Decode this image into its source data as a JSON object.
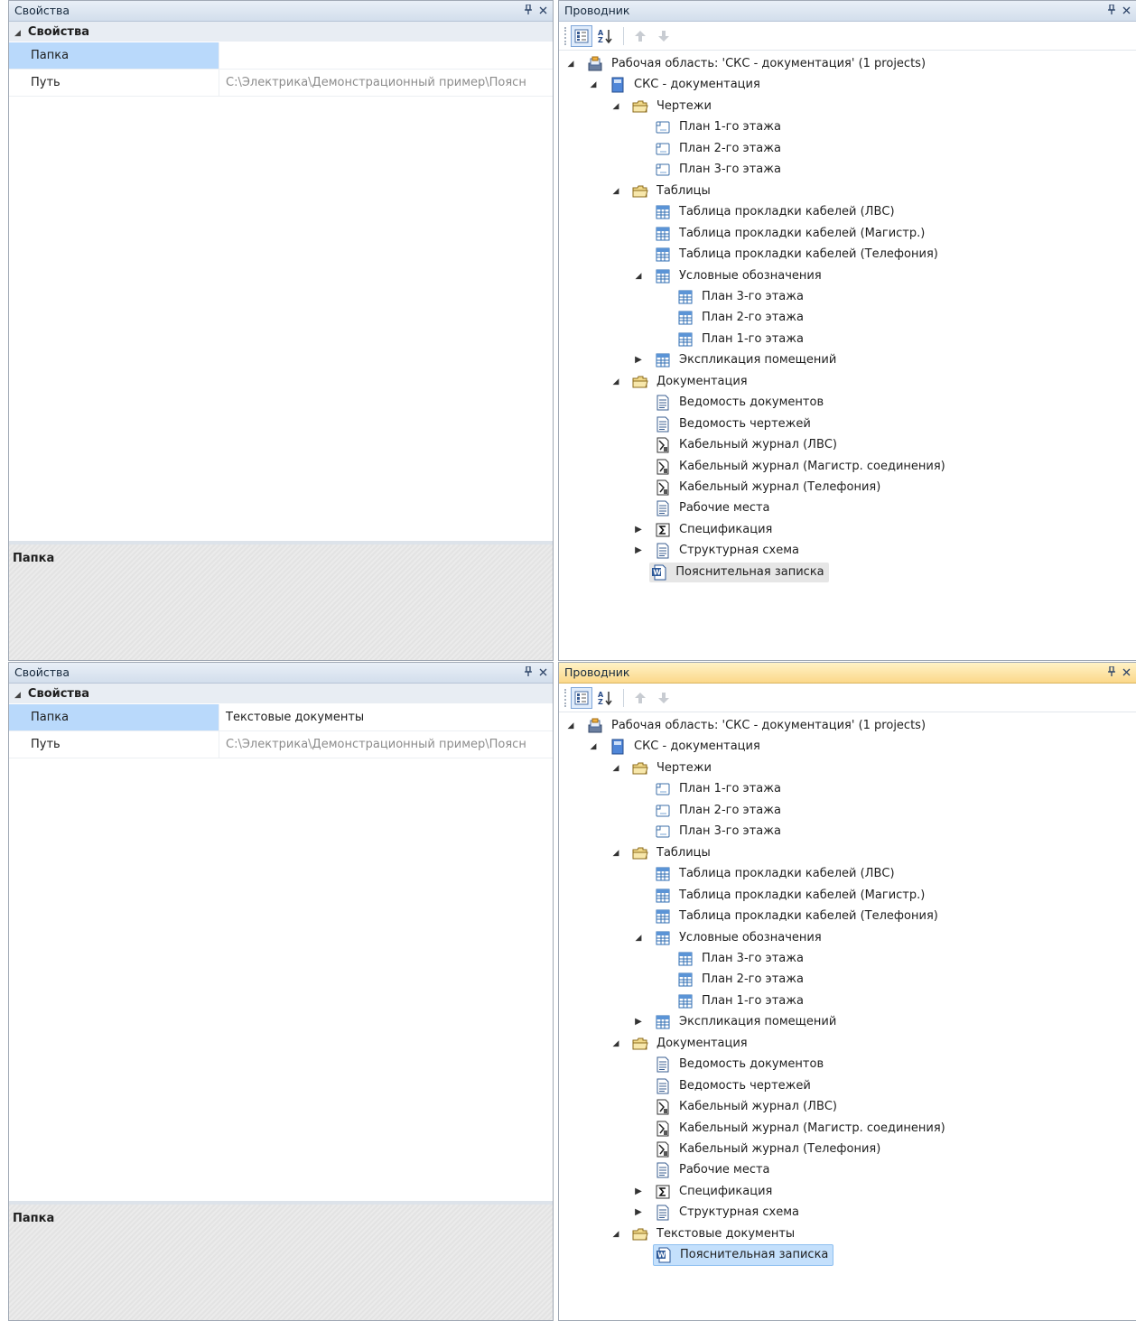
{
  "screens": [
    {
      "properties": {
        "title": "Свойства",
        "category": "Свойства",
        "rows": [
          {
            "name": "Папка",
            "value": ""
          },
          {
            "name": "Путь",
            "value": "C:\\Электрика\\Демонстрационный пример\\Поясн"
          }
        ],
        "description_title": "Папка"
      },
      "explorer": {
        "title": "Проводник",
        "workspace": "Рабочая область: 'СКС - документация' (1 projects)",
        "project": "СКС - документация",
        "folders": [
          {
            "name": "Чертежи",
            "items": [
              "План 1-го этажа",
              "План 2-го этажа",
              "План 3-го этажа"
            ]
          },
          {
            "name": "Таблицы",
            "items": [
              "Таблица прокладки кабелей (ЛВС)",
              "Таблица прокладки кабелей (Магистр.)",
              "Таблица прокладки кабелей (Телефония)"
            ],
            "subgroup": {
              "name": "Условные обозначения",
              "items": [
                "План 3-го этажа",
                "План 2-го этажа",
                "План 1-го этажа"
              ]
            },
            "collapsed": "Экспликация помещений"
          },
          {
            "name": "Документация",
            "items": [
              "Ведомость документов",
              "Ведомость чертежей",
              "Кабельный журнал (ЛВС)",
              "Кабельный журнал (Магистр. соединения)",
              "Кабельный журнал (Телефония)",
              "Рабочие места"
            ],
            "collapsed": [
              "Спецификация",
              "Структурная схема"
            ]
          }
        ],
        "loose_item": "Пояснительная записка"
      }
    },
    {
      "properties": {
        "title": "Свойства",
        "category": "Свойства",
        "rows": [
          {
            "name": "Папка",
            "value": "Текстовые документы"
          },
          {
            "name": "Путь",
            "value": "C:\\Электрика\\Демонстрационный пример\\Поясн"
          }
        ],
        "description_title": "Папка"
      },
      "explorer": {
        "title": "Проводник",
        "workspace": "Рабочая область: 'СКС - документация' (1 projects)",
        "project": "СКС - документация",
        "folders": [
          {
            "name": "Чертежи",
            "items": [
              "План 1-го этажа",
              "План 2-го этажа",
              "План 3-го этажа"
            ]
          },
          {
            "name": "Таблицы",
            "items": [
              "Таблица прокладки кабелей (ЛВС)",
              "Таблица прокладки кабелей (Магистр.)",
              "Таблица прокладки кабелей (Телефония)"
            ],
            "subgroup": {
              "name": "Условные обозначения",
              "items": [
                "План 3-го этажа",
                "План 2-го этажа",
                "План 1-го этажа"
              ]
            },
            "collapsed": "Экспликация помещений"
          },
          {
            "name": "Документация",
            "items": [
              "Ведомость документов",
              "Ведомость чертежей",
              "Кабельный журнал (ЛВС)",
              "Кабельный журнал (Магистр. соединения)",
              "Кабельный журнал (Телефония)",
              "Рабочие места"
            ],
            "collapsed": [
              "Спецификация",
              "Структурная схема"
            ]
          },
          {
            "name": "Текстовые документы",
            "items": [
              "Пояснительная записка"
            ]
          }
        ]
      }
    }
  ],
  "buttons": {
    "pin": "⊥",
    "close": "×"
  },
  "colors": {
    "selection": "#b9d9fb",
    "active_title": "#fbd88a"
  }
}
